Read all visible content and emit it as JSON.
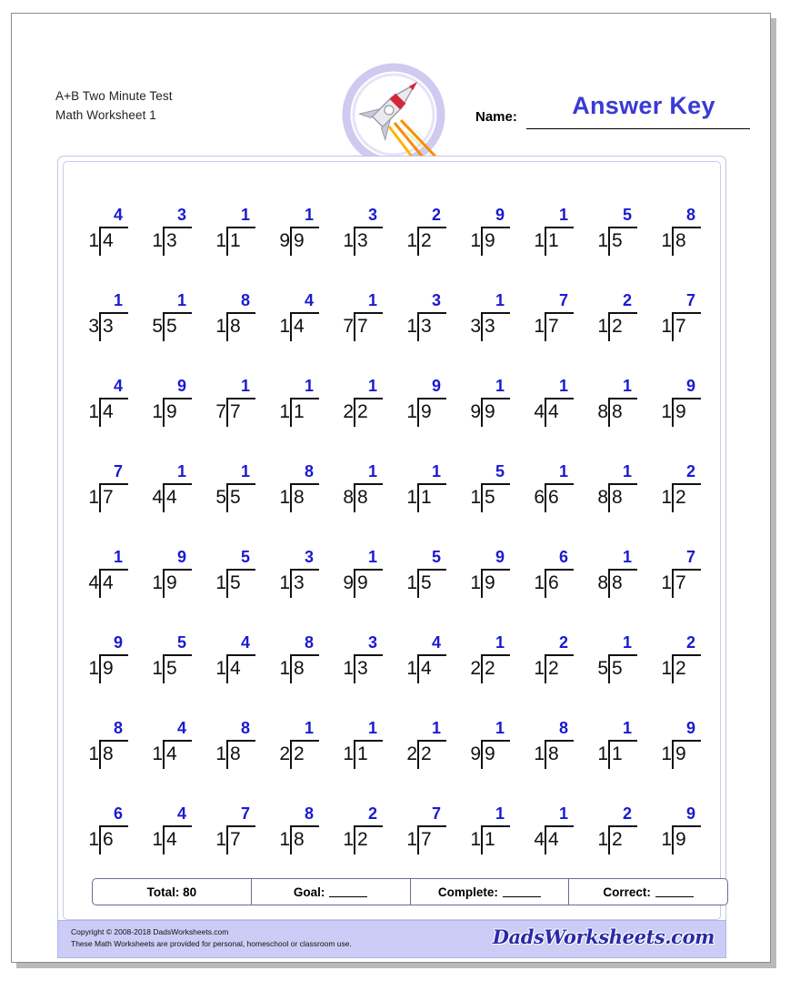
{
  "header": {
    "title_line1": "A+B Two Minute Test",
    "title_line2": "Math Worksheet 1",
    "name_label": "Name:",
    "answer_key": "Answer Key"
  },
  "problems": {
    "rows": [
      [
        {
          "divisor": "1",
          "dividend": "4",
          "quotient": "4"
        },
        {
          "divisor": "1",
          "dividend": "3",
          "quotient": "3"
        },
        {
          "divisor": "1",
          "dividend": "1",
          "quotient": "1"
        },
        {
          "divisor": "9",
          "dividend": "9",
          "quotient": "1"
        },
        {
          "divisor": "1",
          "dividend": "3",
          "quotient": "3"
        },
        {
          "divisor": "1",
          "dividend": "2",
          "quotient": "2"
        },
        {
          "divisor": "1",
          "dividend": "9",
          "quotient": "9"
        },
        {
          "divisor": "1",
          "dividend": "1",
          "quotient": "1"
        },
        {
          "divisor": "1",
          "dividend": "5",
          "quotient": "5"
        },
        {
          "divisor": "1",
          "dividend": "8",
          "quotient": "8"
        }
      ],
      [
        {
          "divisor": "3",
          "dividend": "3",
          "quotient": "1"
        },
        {
          "divisor": "5",
          "dividend": "5",
          "quotient": "1"
        },
        {
          "divisor": "1",
          "dividend": "8",
          "quotient": "8"
        },
        {
          "divisor": "1",
          "dividend": "4",
          "quotient": "4"
        },
        {
          "divisor": "7",
          "dividend": "7",
          "quotient": "1"
        },
        {
          "divisor": "1",
          "dividend": "3",
          "quotient": "3"
        },
        {
          "divisor": "3",
          "dividend": "3",
          "quotient": "1"
        },
        {
          "divisor": "1",
          "dividend": "7",
          "quotient": "7"
        },
        {
          "divisor": "1",
          "dividend": "2",
          "quotient": "2"
        },
        {
          "divisor": "1",
          "dividend": "7",
          "quotient": "7"
        }
      ],
      [
        {
          "divisor": "1",
          "dividend": "4",
          "quotient": "4"
        },
        {
          "divisor": "1",
          "dividend": "9",
          "quotient": "9"
        },
        {
          "divisor": "7",
          "dividend": "7",
          "quotient": "1"
        },
        {
          "divisor": "1",
          "dividend": "1",
          "quotient": "1"
        },
        {
          "divisor": "2",
          "dividend": "2",
          "quotient": "1"
        },
        {
          "divisor": "1",
          "dividend": "9",
          "quotient": "9"
        },
        {
          "divisor": "9",
          "dividend": "9",
          "quotient": "1"
        },
        {
          "divisor": "4",
          "dividend": "4",
          "quotient": "1"
        },
        {
          "divisor": "8",
          "dividend": "8",
          "quotient": "1"
        },
        {
          "divisor": "1",
          "dividend": "9",
          "quotient": "9"
        }
      ],
      [
        {
          "divisor": "1",
          "dividend": "7",
          "quotient": "7"
        },
        {
          "divisor": "4",
          "dividend": "4",
          "quotient": "1"
        },
        {
          "divisor": "5",
          "dividend": "5",
          "quotient": "1"
        },
        {
          "divisor": "1",
          "dividend": "8",
          "quotient": "8"
        },
        {
          "divisor": "8",
          "dividend": "8",
          "quotient": "1"
        },
        {
          "divisor": "1",
          "dividend": "1",
          "quotient": "1"
        },
        {
          "divisor": "1",
          "dividend": "5",
          "quotient": "5"
        },
        {
          "divisor": "6",
          "dividend": "6",
          "quotient": "1"
        },
        {
          "divisor": "8",
          "dividend": "8",
          "quotient": "1"
        },
        {
          "divisor": "1",
          "dividend": "2",
          "quotient": "2"
        }
      ],
      [
        {
          "divisor": "4",
          "dividend": "4",
          "quotient": "1"
        },
        {
          "divisor": "1",
          "dividend": "9",
          "quotient": "9"
        },
        {
          "divisor": "1",
          "dividend": "5",
          "quotient": "5"
        },
        {
          "divisor": "1",
          "dividend": "3",
          "quotient": "3"
        },
        {
          "divisor": "9",
          "dividend": "9",
          "quotient": "1"
        },
        {
          "divisor": "1",
          "dividend": "5",
          "quotient": "5"
        },
        {
          "divisor": "1",
          "dividend": "9",
          "quotient": "9"
        },
        {
          "divisor": "1",
          "dividend": "6",
          "quotient": "6"
        },
        {
          "divisor": "8",
          "dividend": "8",
          "quotient": "1"
        },
        {
          "divisor": "1",
          "dividend": "7",
          "quotient": "7"
        }
      ],
      [
        {
          "divisor": "1",
          "dividend": "9",
          "quotient": "9"
        },
        {
          "divisor": "1",
          "dividend": "5",
          "quotient": "5"
        },
        {
          "divisor": "1",
          "dividend": "4",
          "quotient": "4"
        },
        {
          "divisor": "1",
          "dividend": "8",
          "quotient": "8"
        },
        {
          "divisor": "1",
          "dividend": "3",
          "quotient": "3"
        },
        {
          "divisor": "1",
          "dividend": "4",
          "quotient": "4"
        },
        {
          "divisor": "2",
          "dividend": "2",
          "quotient": "1"
        },
        {
          "divisor": "1",
          "dividend": "2",
          "quotient": "2"
        },
        {
          "divisor": "5",
          "dividend": "5",
          "quotient": "1"
        },
        {
          "divisor": "1",
          "dividend": "2",
          "quotient": "2"
        }
      ],
      [
        {
          "divisor": "1",
          "dividend": "8",
          "quotient": "8"
        },
        {
          "divisor": "1",
          "dividend": "4",
          "quotient": "4"
        },
        {
          "divisor": "1",
          "dividend": "8",
          "quotient": "8"
        },
        {
          "divisor": "2",
          "dividend": "2",
          "quotient": "1"
        },
        {
          "divisor": "1",
          "dividend": "1",
          "quotient": "1"
        },
        {
          "divisor": "2",
          "dividend": "2",
          "quotient": "1"
        },
        {
          "divisor": "9",
          "dividend": "9",
          "quotient": "1"
        },
        {
          "divisor": "1",
          "dividend": "8",
          "quotient": "8"
        },
        {
          "divisor": "1",
          "dividend": "1",
          "quotient": "1"
        },
        {
          "divisor": "1",
          "dividend": "9",
          "quotient": "9"
        }
      ],
      [
        {
          "divisor": "1",
          "dividend": "6",
          "quotient": "6"
        },
        {
          "divisor": "1",
          "dividend": "4",
          "quotient": "4"
        },
        {
          "divisor": "1",
          "dividend": "7",
          "quotient": "7"
        },
        {
          "divisor": "1",
          "dividend": "8",
          "quotient": "8"
        },
        {
          "divisor": "1",
          "dividend": "2",
          "quotient": "2"
        },
        {
          "divisor": "1",
          "dividend": "7",
          "quotient": "7"
        },
        {
          "divisor": "1",
          "dividend": "1",
          "quotient": "1"
        },
        {
          "divisor": "4",
          "dividend": "4",
          "quotient": "1"
        },
        {
          "divisor": "1",
          "dividend": "2",
          "quotient": "2"
        },
        {
          "divisor": "1",
          "dividend": "9",
          "quotient": "9"
        }
      ]
    ]
  },
  "totals": {
    "total": "Total: 80",
    "goal": "Goal:",
    "complete": "Complete:",
    "correct": "Correct:"
  },
  "footer": {
    "copyright": "Copyright © 2008-2018 DadsWorksheets.com",
    "usage": "These Math Worksheets are provided for personal, homeschool or classroom use.",
    "logo": "DadsWorksheets.com"
  },
  "colors": {
    "answer_blue": "#1a1ad0",
    "footer_band": "#ccccf6",
    "frame_border": "#c3c3e8"
  }
}
